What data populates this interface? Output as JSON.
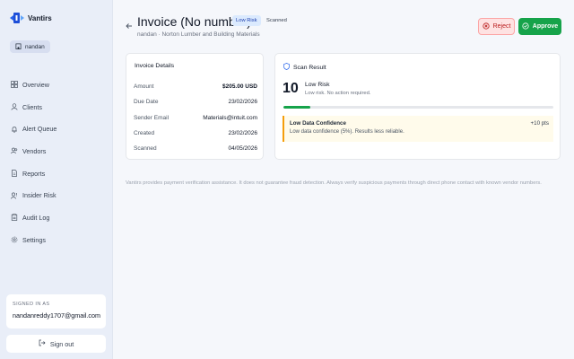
{
  "app": {
    "name": "Vantirs",
    "workspace": "nandan"
  },
  "nav": [
    {
      "label": "Overview",
      "icon": "grid-icon"
    },
    {
      "label": "Clients",
      "icon": "user-icon"
    },
    {
      "label": "Alert Queue",
      "icon": "bell-icon"
    },
    {
      "label": "Vendors",
      "icon": "users-icon"
    },
    {
      "label": "Reports",
      "icon": "file-icon"
    },
    {
      "label": "Insider Risk",
      "icon": "user-alert-icon"
    },
    {
      "label": "Audit Log",
      "icon": "clipboard-icon"
    },
    {
      "label": "Settings",
      "icon": "gear-icon"
    }
  ],
  "account": {
    "signed_in_label": "SIGNED IN AS",
    "email": "nandanreddy1707@gmail.com",
    "signout_label": "Sign out"
  },
  "header": {
    "title": "Invoice (No number)",
    "risk_badge": "Low Risk",
    "status_badge": "Scanned",
    "subtitle": "nandan · Norton Lumber and Building Materials",
    "reject_label": "Reject",
    "approve_label": "Approve"
  },
  "details": {
    "title": "Invoice Details",
    "rows": [
      {
        "label": "Amount",
        "value": "$205.00 USD"
      },
      {
        "label": "Due Date",
        "value": "23/02/2026"
      },
      {
        "label": "Sender Email",
        "value": "Materials@intuit.com"
      },
      {
        "label": "Created",
        "value": "23/02/2026"
      },
      {
        "label": "Scanned",
        "value": "04/05/2026"
      }
    ]
  },
  "scan": {
    "title": "Scan Result",
    "score": "10",
    "score_fraction": 0.1,
    "risk_label": "Low Risk",
    "risk_desc": "Low risk. No action required.",
    "flag": {
      "title": "Low Data Confidence",
      "points": "+10 pts",
      "desc": "Low data confidence (5%). Results less reliable."
    }
  },
  "disclaimer": "Vantirs provides payment verification assistance. It does not guarantee fraud detection. Always verify suspicious payments through direct phone contact with known vendor numbers.",
  "colors": {
    "accent": "#16a34a",
    "danger": "#b91c1c",
    "warning": "#f59e0b",
    "badge": "#1e40af"
  }
}
